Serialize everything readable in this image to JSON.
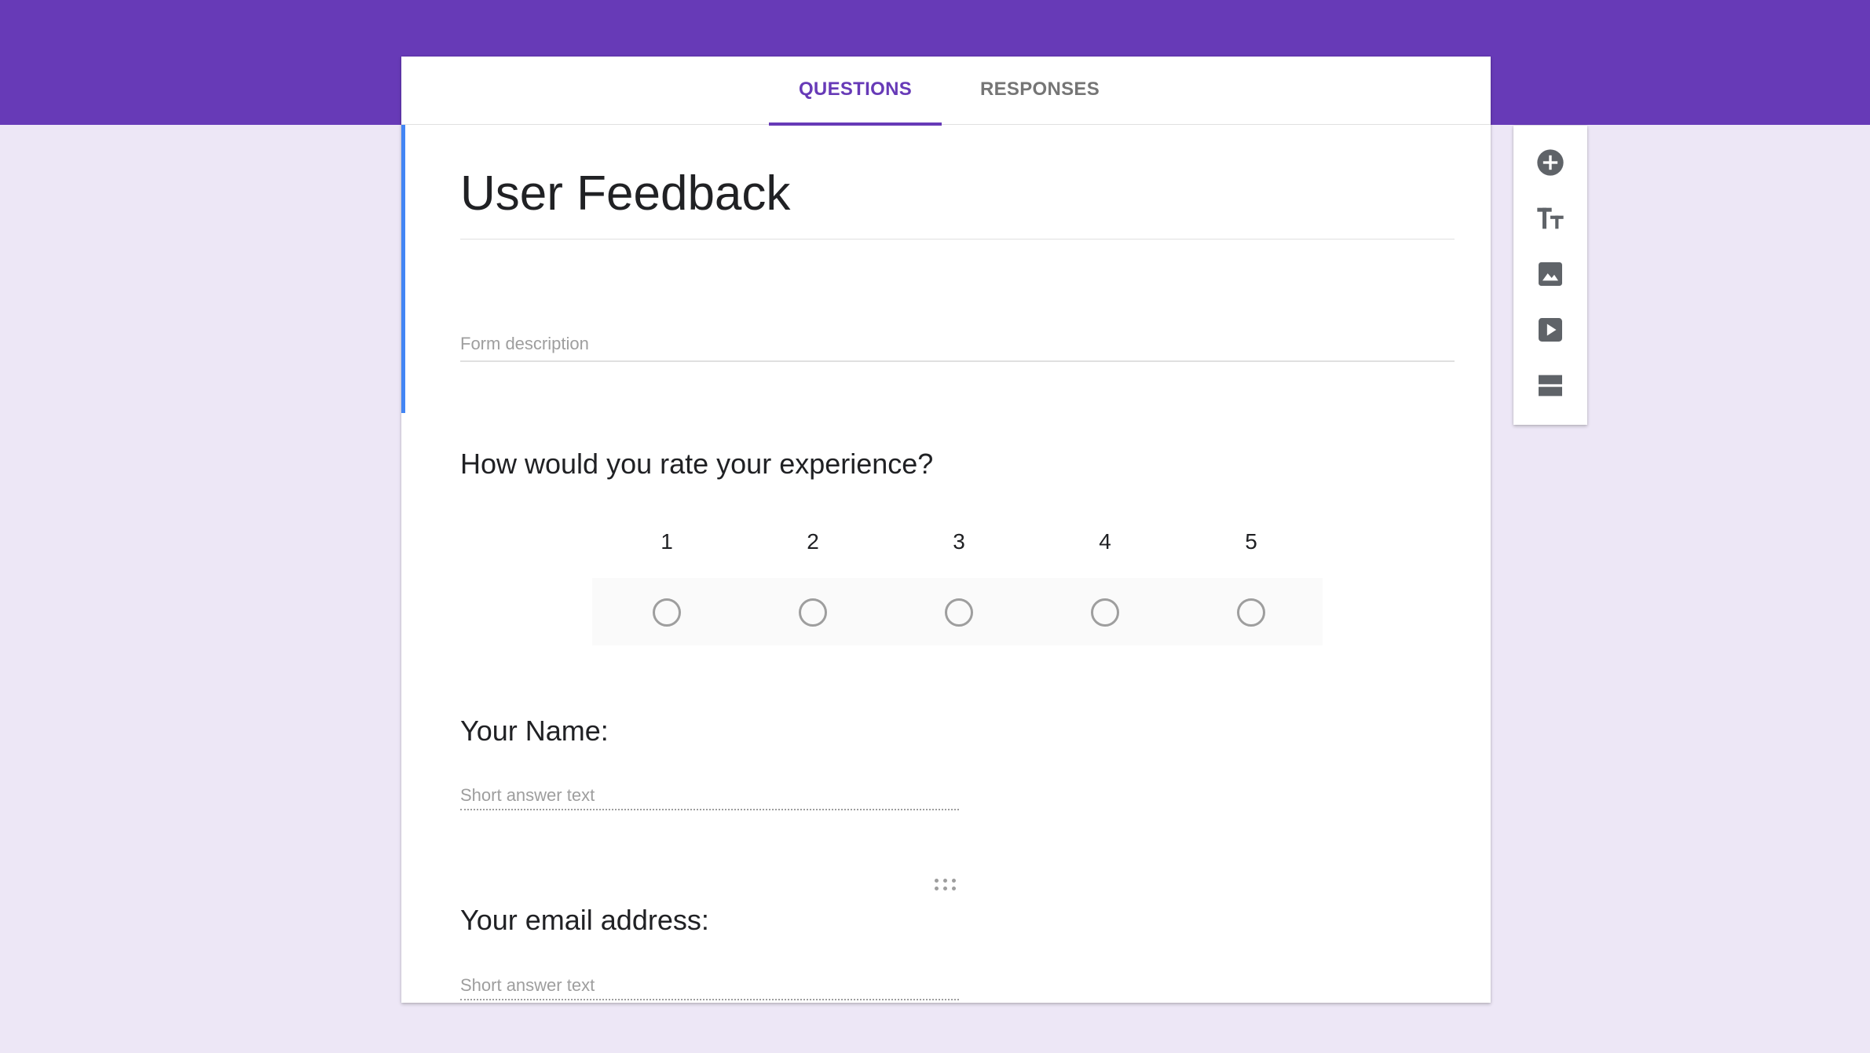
{
  "header": {
    "accent_color": "#673ab7",
    "tabs": [
      {
        "label": "QUESTIONS",
        "active": true
      },
      {
        "label": "RESPONSES",
        "active": false
      }
    ]
  },
  "form": {
    "title": "User Feedback",
    "description_placeholder": "Form description",
    "questions": [
      {
        "type": "linear-scale",
        "title": "How would you rate your experience?",
        "scale": [
          "1",
          "2",
          "3",
          "4",
          "5"
        ]
      },
      {
        "type": "short-answer",
        "title": "Your Name:",
        "placeholder": "Short answer text"
      },
      {
        "type": "short-answer",
        "title": "Your email address:",
        "placeholder": "Short answer text"
      }
    ]
  },
  "sidebar": {
    "tools": [
      {
        "icon": "add-circle-icon"
      },
      {
        "icon": "title-text-icon"
      },
      {
        "icon": "image-icon"
      },
      {
        "icon": "video-icon"
      },
      {
        "icon": "section-icon"
      }
    ]
  }
}
